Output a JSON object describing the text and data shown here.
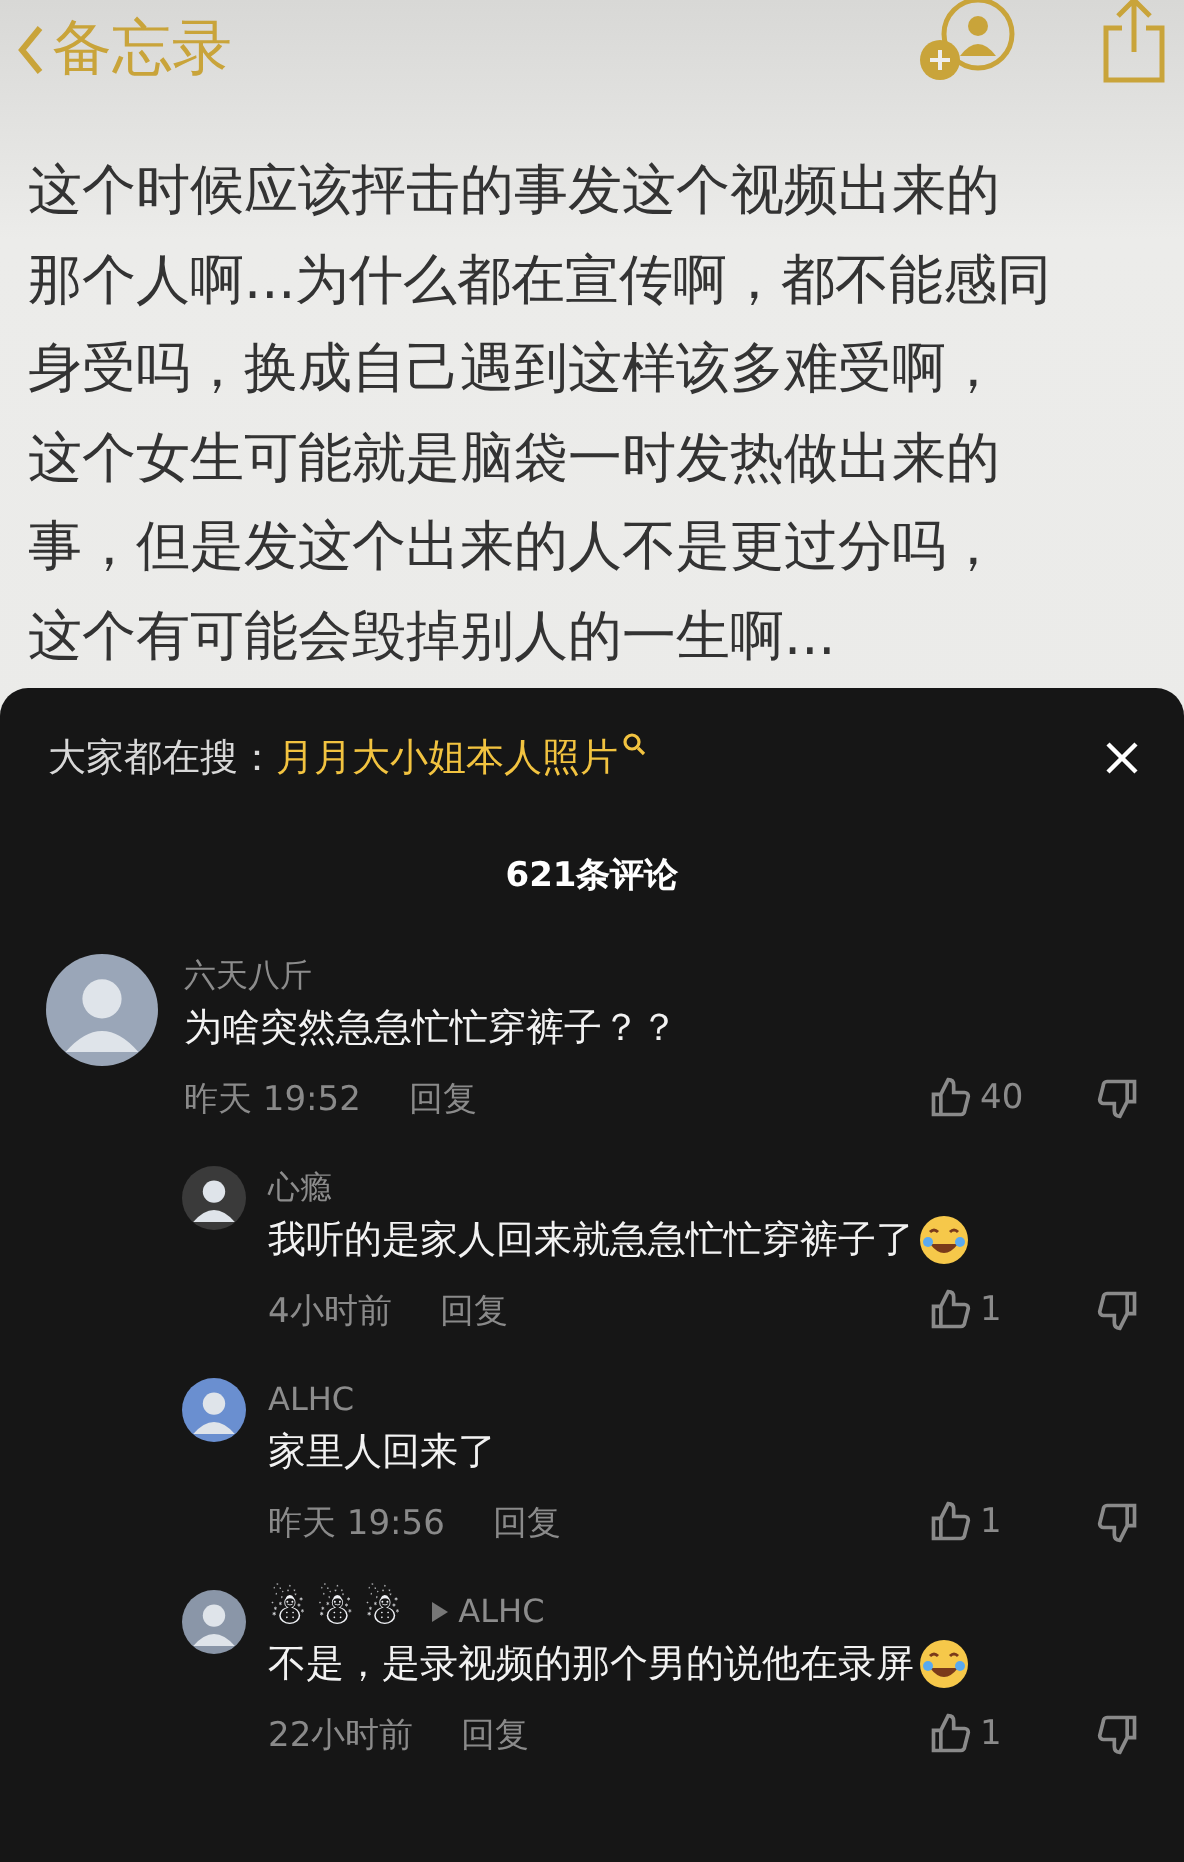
{
  "header": {
    "back_label": "备忘录"
  },
  "note": {
    "lines": [
      "这个时候应该抨击的事发这个视频出来的",
      "那个人啊...为什么都在宣传啊，都不能感同",
      "身受吗，换成自己遇到这样该多难受啊，",
      "这个女生可能就是脑袋一时发热做出来的",
      "事，但是发这个出来的人不是更过分吗，",
      "这个有可能会毁掉别人的一生啊..."
    ]
  },
  "comments_sheet": {
    "search_label": "大家都在搜：",
    "search_term": "月月大小姐本人照片",
    "count": "621条评论",
    "comments": [
      {
        "kind": "top",
        "name": "六天八斤",
        "text": "为啥突然急急忙忙穿裤子？？",
        "time": "昨天 19:52",
        "reply": "回复",
        "likes": "40"
      },
      {
        "kind": "reply",
        "name": "心瘾",
        "text": "我听的是家人回来就急急忙忙穿裤子了",
        "emoji": true,
        "time": "4小时前",
        "reply": "回复",
        "likes": "1"
      },
      {
        "kind": "reply",
        "name": "ALHC",
        "text": "家里人回来了",
        "time": "昨天 19:56",
        "reply": "回复",
        "likes": "1"
      },
      {
        "kind": "reply",
        "name": "☃☃☃",
        "reply_to": "ALHC",
        "text": "不是，是录视频的那个男的说他在录屏",
        "emoji": true,
        "time": "22小时前",
        "reply": "回复",
        "likes": "1"
      }
    ]
  }
}
